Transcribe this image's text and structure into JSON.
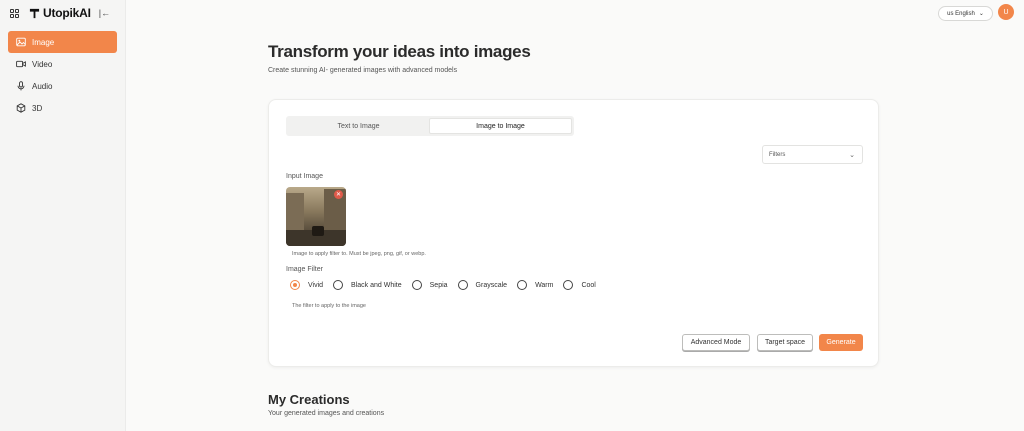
{
  "app": {
    "name": "UtopikAI"
  },
  "sidebar": {
    "items": [
      {
        "label": "Image",
        "icon": "image-icon",
        "active": true
      },
      {
        "label": "Video",
        "icon": "video-icon",
        "active": false
      },
      {
        "label": "Audio",
        "icon": "microphone-icon",
        "active": false
      },
      {
        "label": "3D",
        "icon": "cube-icon",
        "active": false
      }
    ]
  },
  "topbar": {
    "language": "us English",
    "avatar_initial": "U"
  },
  "main": {
    "title": "Transform your ideas into images",
    "subtitle": "Create stunning AI- generated images with advanced models"
  },
  "generator": {
    "tabs": [
      {
        "label": "Text to Image",
        "active": false
      },
      {
        "label": "Image to Image",
        "active": true
      }
    ],
    "filters_placeholder": "Filters",
    "input_image_label": "Input Image",
    "input_image_help": "Image to apply filter to. Must be jpeg, png, gif, or webp.",
    "image_filter_label": "Image Filter",
    "filter_options": [
      {
        "label": "Vivid",
        "checked": true
      },
      {
        "label": "Black and White",
        "checked": false
      },
      {
        "label": "Sepia",
        "checked": false
      },
      {
        "label": "Grayscale",
        "checked": false
      },
      {
        "label": "Warm",
        "checked": false
      },
      {
        "label": "Cool",
        "checked": false
      }
    ],
    "filter_help": "The filter to apply to the image",
    "buttons": {
      "advanced": "Advanced Mode",
      "target": "Target space",
      "generate": "Generate"
    }
  },
  "creations": {
    "title": "My Creations",
    "subtitle": "Your generated images and creations"
  },
  "colors": {
    "accent": "#f2864a"
  }
}
